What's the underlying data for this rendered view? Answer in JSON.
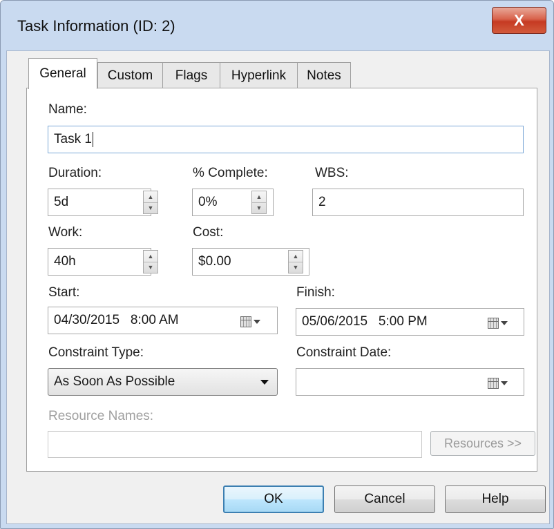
{
  "window": {
    "title": "Task Information (ID: 2)",
    "close_glyph": "X"
  },
  "tabs": [
    {
      "label": "General",
      "active": true
    },
    {
      "label": "Custom"
    },
    {
      "label": "Flags"
    },
    {
      "label": "Hyperlink"
    },
    {
      "label": "Notes"
    }
  ],
  "form": {
    "name_label": "Name:",
    "name_value": "Task 1",
    "duration_label": "Duration:",
    "duration_value": "5d",
    "complete_label": "% Complete:",
    "complete_value": "0%",
    "wbs_label": "WBS:",
    "wbs_value": "2",
    "work_label": "Work:",
    "work_value": "40h",
    "cost_label": "Cost:",
    "cost_value": "$0.00",
    "start_label": "Start:",
    "start_value": "04/30/2015   8:00 AM",
    "finish_label": "Finish:",
    "finish_value": "05/06/2015   5:00 PM",
    "constraint_type_label": "Constraint Type:",
    "constraint_type_value": "As Soon As Possible",
    "constraint_date_label": "Constraint Date:",
    "constraint_date_value": "",
    "resource_names_label": "Resource Names:",
    "resource_names_value": "",
    "resources_button": "Resources >>"
  },
  "buttons": {
    "ok": "OK",
    "cancel": "Cancel",
    "help": "Help"
  },
  "icons": {
    "close": "close-icon",
    "spin": "spin-updown-icon",
    "calendar": "calendar-dropdown-icon",
    "dropdown": "chevron-down-icon"
  },
  "colors": {
    "frame": "#c9daf0",
    "close_button": "#c63a22",
    "dialog_bg": "#f0f0f0",
    "default_button_border": "#3c7fb1"
  }
}
